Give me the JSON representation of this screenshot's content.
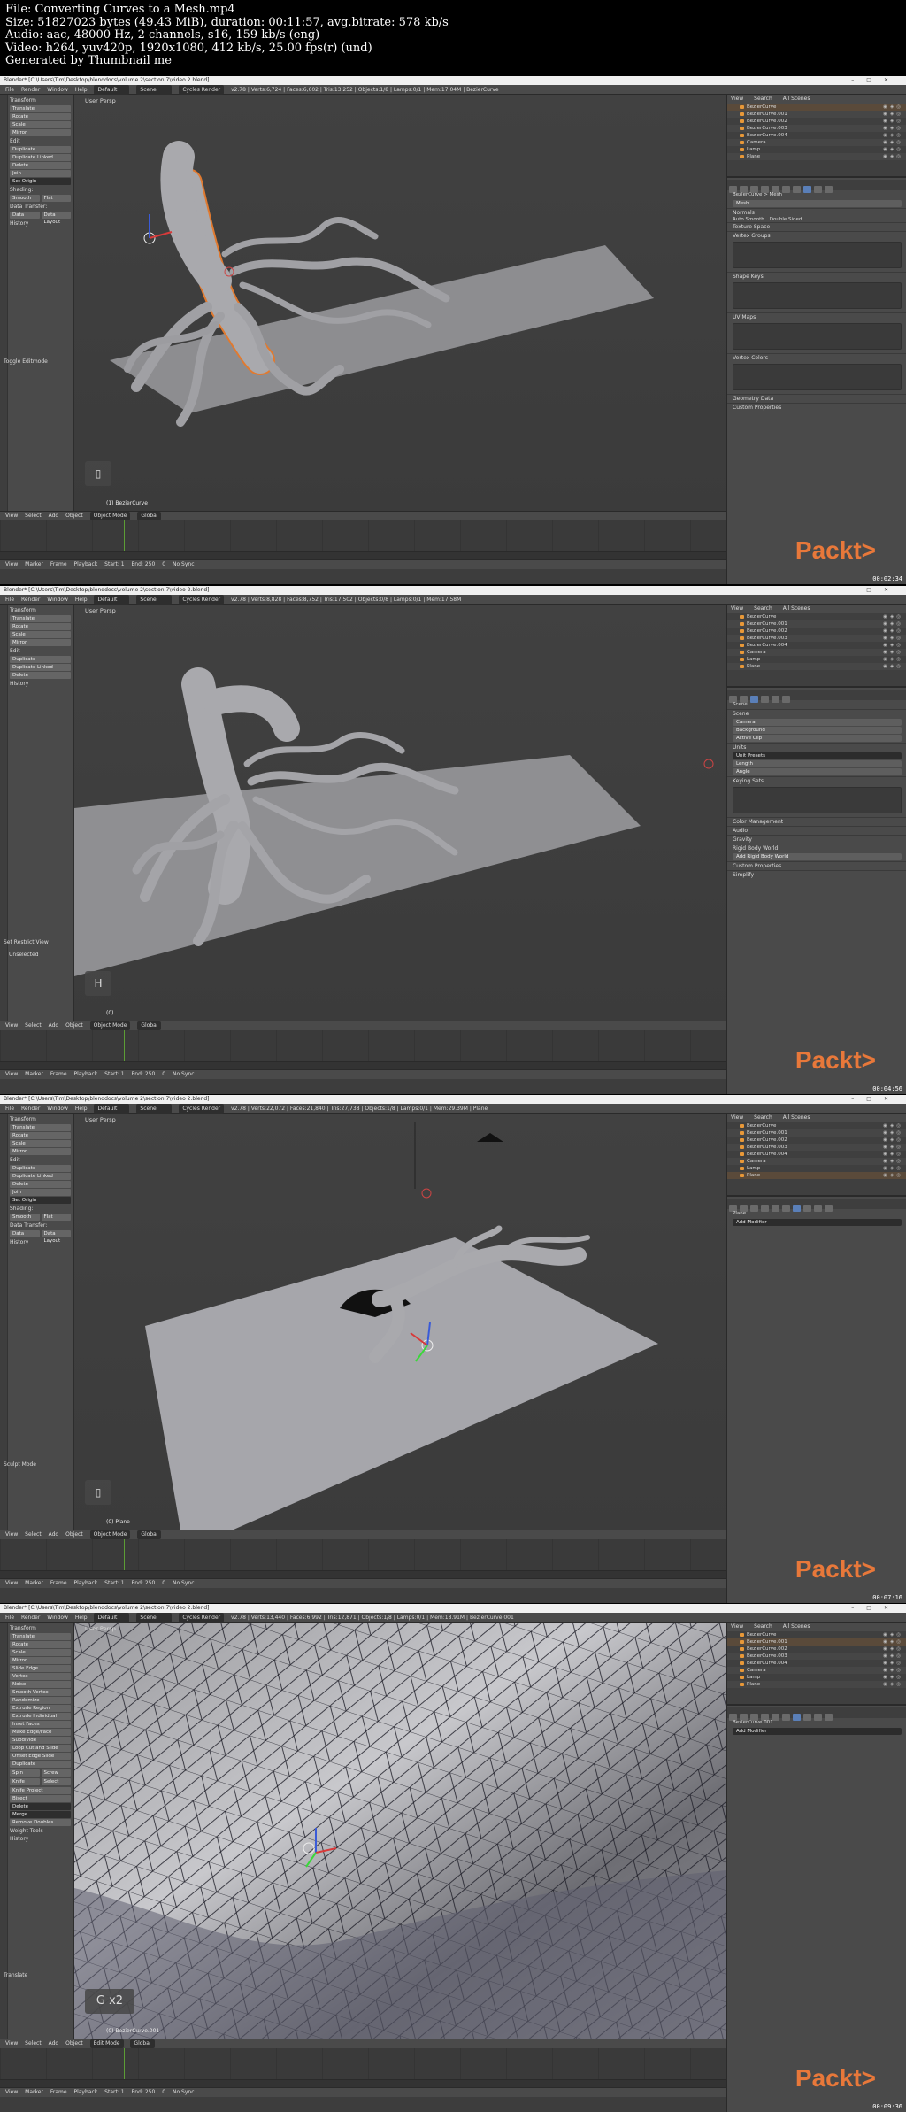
{
  "header": {
    "line1": "File: Converting Curves to a Mesh.mp4",
    "line2": "Size: 51827023 bytes (49.43 MiB), duration: 00:11:57, avg.bitrate: 578 kb/s",
    "line3": "Audio: aac, 48000 Hz, 2 channels, s16, 159 kb/s (eng)",
    "line4": "Video: h264, yuv420p, 1920x1080, 412 kb/s, 25.00 fps(r) (und)",
    "line5": "Generated by Thumbnail me"
  },
  "common": {
    "menus": [
      "File",
      "Render",
      "Window",
      "Help"
    ],
    "layout": "Default",
    "scene": "Scene",
    "engine": "Cycles Render",
    "vp_menus": [
      "View",
      "Select",
      "Add",
      "Object"
    ],
    "tl_menus": [
      "View",
      "Marker",
      "Frame",
      "Playback"
    ],
    "tl_start": "Start: 1",
    "tl_end": "End: 250",
    "tl_frame": "0",
    "orientation": "Global",
    "sync": "No Sync",
    "outliner_menus": [
      "View",
      "Search",
      "All Scenes"
    ],
    "outliner_items": [
      "BezierCurve",
      "BezierCurve.001",
      "BezierCurve.002",
      "BezierCurve.003",
      "BezierCurve.004",
      "Camera",
      "Lamp",
      "Plane"
    ],
    "tools": [
      "Translate",
      "Rotate",
      "Scale",
      "Mirror"
    ],
    "edit_tools": [
      "Duplicate",
      "Duplicate Linked",
      "Delete",
      "Join"
    ],
    "set_origin": "Set Origin",
    "shading_tools": [
      "Smooth",
      "Flat"
    ],
    "data_transfer": [
      "Data",
      "Data Layout"
    ],
    "sec_transform": "Transform",
    "sec_edit": "Edit",
    "sec_shading": "Shading:",
    "sec_data": "Data Transfer:",
    "sec_history": "History",
    "brand": "Packt>"
  },
  "frames": [
    {
      "title": "Blender* [C:\\Users\\Tim\\Desktop\\blenddocs\\volume 2\\section 7\\video 2.blend]",
      "stats": "v2.78 | Verts:6,724 | Faces:6,602 | Tris:13,252 | Objects:1/8 | Lamps:0/1 | Mem:17.04M | BezierCurve",
      "view": "User Persp",
      "object": "(1) BezierCurve",
      "key": "",
      "mode": "Object Mode",
      "op": "Toggle Editmode",
      "prop_path": "BezierCurve  >  Mesh",
      "prop_sections": [
        "Mesh",
        "Normals",
        "Auto Smooth",
        "Double Sided",
        "Texture Space",
        "Vertex Groups",
        "Shape Keys",
        "UV Maps",
        "Vertex Colors",
        "Geometry Data",
        "Custom Properties"
      ],
      "time": "00:02:34"
    },
    {
      "title": "Blender* [C:\\Users\\Tim\\Desktop\\blenddocs\\volume 2\\section 7\\video 2.blend]",
      "stats": "v2.78 | Verts:8,828 | Faces:8,752 | Tris:17,502 | Objects:0/8 | Lamps:0/1 | Mem:17.58M",
      "view": "User Persp",
      "object": "(0)",
      "key": "H",
      "mode": "Object Mode",
      "op": "Set Restrict View",
      "op_extra": "Unselected",
      "prop_path": "Scene",
      "prop_sections": [
        "Scene",
        "Camera",
        "Background",
        "Active Clip",
        "Units",
        "Unit Presets",
        "Length",
        "Angle",
        "Keying Sets",
        "Color Management",
        "Audio",
        "Gravity",
        "Rigid Body World",
        "Add Rigid Body World",
        "Custom Properties",
        "Simplify"
      ],
      "time": "00:04:56"
    },
    {
      "title": "Blender* [C:\\Users\\Tim\\Desktop\\blenddocs\\volume 2\\section 7\\video 2.blend]",
      "stats": "v2.78 | Verts:22,072 | Faces:21,840 | Tris:27,738 | Objects:1/8 | Lamps:0/1 | Mem:29.39M | Plane",
      "view": "User Persp",
      "object": "(0) Plane",
      "key": "",
      "mode": "Object Mode",
      "op": "Sculpt Mode",
      "prop_path": "Plane",
      "prop_sections": [
        "Add Modifier"
      ],
      "time": "00:07:16"
    },
    {
      "title": "Blender* [C:\\Users\\Tim\\Desktop\\blenddocs\\volume 2\\section 7\\video 2.blend]",
      "stats": "v2.78 | Verts:13,440 | Faces:6,992 | Tris:12,871 | Objects:1/8 | Lamps:0/1 | Mem:18.91M | BezierCurve.001",
      "view": "User Persp",
      "object": "(0) BezierCurve.001",
      "key": "G x2",
      "mode": "Edit Mode",
      "op": "Translate",
      "prop_path": "BezierCurve.001",
      "prop_sections": [
        "Add Modifier"
      ],
      "time": "00:09:36"
    }
  ],
  "mesh_tools": [
    "Slide Edge",
    "Vertex",
    "Noise",
    "Smooth Vertex",
    "Randomize",
    "Extrude Region",
    "Extrude Individual",
    "Inset Faces",
    "Make Edge/Face",
    "Subdivide",
    "Loop Cut and Slide",
    "Offset Edge Slide",
    "Duplicate",
    "Spin",
    "Screw",
    "Knife",
    "Select",
    "Knife Project",
    "Bisect",
    "Delete",
    "Merge",
    "Remove Doubles",
    "Weight Tools"
  ]
}
